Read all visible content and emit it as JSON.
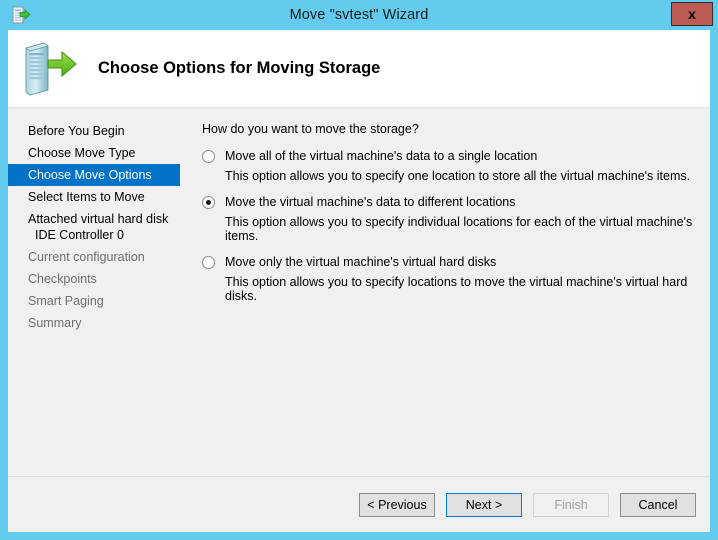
{
  "titlebar": {
    "title": "Move \"svtest\" Wizard",
    "close_label": "x",
    "icon": "move-storage-icon",
    "background": "#62cbee"
  },
  "banner": {
    "heading": "Choose Options for Moving Storage",
    "icon": "server-move-icon"
  },
  "sidebar": {
    "items": [
      {
        "label": "Before You Begin",
        "state": "normal"
      },
      {
        "label": "Choose Move Type",
        "state": "normal"
      },
      {
        "label": "Choose Move Options",
        "state": "selected"
      },
      {
        "label": "Select Items to Move",
        "state": "normal"
      },
      {
        "label": "Attached virtual hard disk",
        "sub": "IDE Controller 0",
        "state": "normal"
      },
      {
        "label": "Current configuration",
        "state": "disabled"
      },
      {
        "label": "Checkpoints",
        "state": "disabled"
      },
      {
        "label": "Smart Paging",
        "state": "disabled"
      },
      {
        "label": "Summary",
        "state": "disabled"
      }
    ],
    "selected_background": "#0272c7",
    "disabled_color": "#6e6e6e"
  },
  "content": {
    "question": "How do you want to move the storage?",
    "options": [
      {
        "label": "Move all of the virtual machine's data to a single location",
        "description": "This option allows you to specify one location to store all the virtual machine's items.",
        "selected": false
      },
      {
        "label": "Move the virtual machine's data to different locations",
        "description": "This option allows you to specify individual locations for each of the virtual machine's items.",
        "selected": true
      },
      {
        "label": "Move only the virtual machine's virtual hard disks",
        "description": "This option allows you to specify locations to move the virtual machine's virtual hard disks.",
        "selected": false
      }
    ]
  },
  "footer": {
    "previous_label": "< Previous",
    "next_label": "Next >",
    "finish_label": "Finish",
    "cancel_label": "Cancel",
    "default_button_accent": "#0078d7"
  }
}
